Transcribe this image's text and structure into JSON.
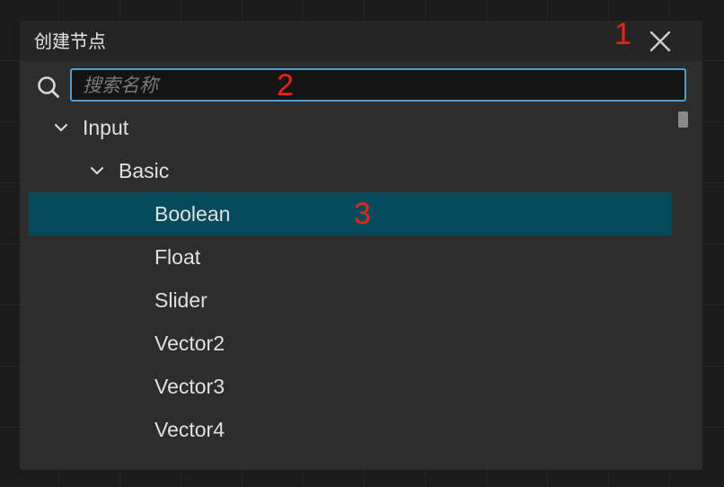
{
  "dialog": {
    "title": "创建节点",
    "close_icon": "close-icon"
  },
  "search": {
    "icon": "search-icon",
    "placeholder": "搜索名称",
    "value": "",
    "border_color": "#4d9ed6"
  },
  "tree": {
    "items": [
      {
        "label": "Input",
        "expanded": true,
        "icon": "chevron-down-icon"
      },
      {
        "label": "Basic",
        "expanded": true,
        "icon": "chevron-down-icon"
      },
      {
        "label": "Boolean",
        "selected": true
      },
      {
        "label": "Float"
      },
      {
        "label": "Slider"
      },
      {
        "label": "Vector2"
      },
      {
        "label": "Vector3"
      },
      {
        "label": "Vector4"
      }
    ],
    "selected_color": "#074a5c"
  },
  "annotations": [
    "1",
    "2",
    "3"
  ]
}
